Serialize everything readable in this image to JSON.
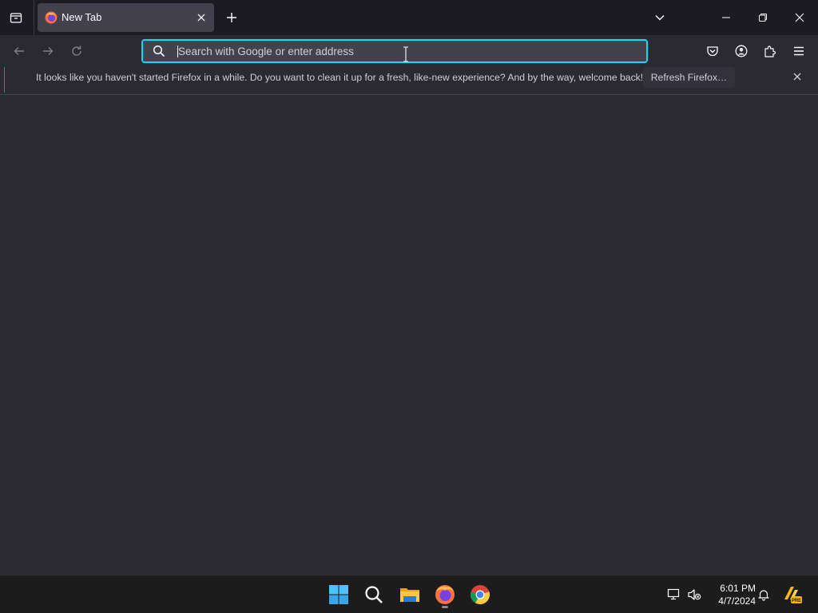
{
  "window": {
    "tab_title": "New Tab"
  },
  "urlbar": {
    "placeholder": "Search with Google or enter address",
    "value": ""
  },
  "notification": {
    "message": "It looks like you haven't started Firefox in a while. Do you want to clean it up for a fresh, like-new experience? And by the way, welcome back!",
    "action_label": "Refresh Firefox…"
  },
  "taskbar": {
    "time": "6:01 PM",
    "date": "4/7/2024",
    "apps": [
      "start-icon",
      "search-icon",
      "file-explorer-icon",
      "firefox-icon",
      "chrome-icon"
    ],
    "tray_badge": "PRE"
  },
  "colors": {
    "accent": "#00ddff",
    "notification_accent": "#d43a78",
    "toolbar_bg": "#2b2a33",
    "tabstrip_bg": "#1c1b22",
    "taskbar_bg": "#1c1c1c"
  }
}
